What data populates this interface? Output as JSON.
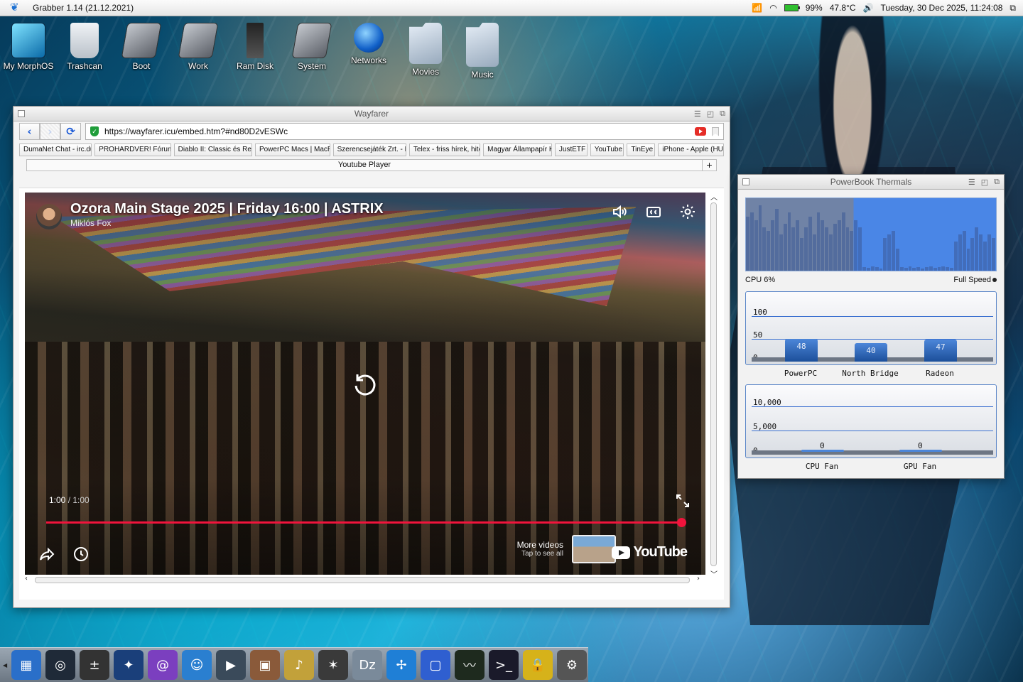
{
  "menubar": {
    "app_title": "Grabber 1.14 (21.12.2021)",
    "battery": "99%",
    "temperature": "47.8°C",
    "clock": "Tuesday, 30 Dec 2025, 11:24:08"
  },
  "desktop_icons": [
    {
      "label": "My MorphOS",
      "icon": "morphos-drive-icon"
    },
    {
      "label": "Trashcan",
      "icon": "trashcan-icon"
    },
    {
      "label": "Boot",
      "icon": "boot-drive-icon"
    },
    {
      "label": "Work",
      "icon": "work-drive-icon"
    },
    {
      "label": "Ram Disk",
      "icon": "ram-disk-icon"
    },
    {
      "label": "System",
      "icon": "system-drive-icon"
    },
    {
      "label": "Networks",
      "icon": "globe-icon"
    },
    {
      "label": "Movies",
      "icon": "folder-link-icon"
    },
    {
      "label": "Music",
      "icon": "folder-link-icon"
    }
  ],
  "wayfarer": {
    "title": "Wayfarer",
    "url": "https://wayfarer.icu/embed.htm?#nd80D2vESWc",
    "bookmarks": [
      "DumaNet Chat - irc.du",
      "PROHARDVER! Fórum",
      "Diablo II: Classic és Res",
      "PowerPC Macs | MacR",
      "Szerencsejáték Zrt. - L",
      "Telex - friss hírek, hite",
      "Magyar Állampapír K",
      "JustETF",
      "YouTube",
      "TinEye",
      "iPhone - Apple (HU)"
    ],
    "tab": "Youtube Player",
    "tab_add": "+",
    "video": {
      "title": "Ozora Main Stage 2025 | Friday 16:00 | ASTRIX",
      "channel": "Miklós Fox",
      "time_current": "1:00",
      "time_sep": " / ",
      "time_total": "1:00",
      "progress": 1.0,
      "more_videos": "More videos",
      "more_videos_sub": "Tap to see all",
      "logo_text": "YouTube"
    }
  },
  "thermals": {
    "title": "PowerBook Thermals",
    "cpu_label": "CPU 6%",
    "speed_label": "Full Speed",
    "cpu_history": [
      0.75,
      0.8,
      0.7,
      0.9,
      0.6,
      0.55,
      0.7,
      0.85,
      0.5,
      0.65,
      0.8,
      0.6,
      0.7,
      0.45,
      0.6,
      0.75,
      0.5,
      0.8,
      0.7,
      0.6,
      0.5,
      0.65,
      0.7,
      0.8,
      0.6,
      0.55,
      0.7,
      0.6,
      0.05,
      0.04,
      0.06,
      0.05,
      0.03,
      0.45,
      0.5,
      0.55,
      0.3,
      0.05,
      0.04,
      0.06,
      0.04,
      0.05,
      0.03,
      0.05,
      0.06,
      0.04,
      0.05,
      0.06,
      0.05,
      0.04,
      0.4,
      0.5,
      0.55,
      0.3,
      0.45,
      0.6,
      0.5,
      0.4,
      0.5,
      0.45
    ],
    "temp_chart": {
      "type": "bar",
      "categories": [
        "PowerPC",
        "North Bridge",
        "Radeon"
      ],
      "values": [
        48,
        40,
        47
      ],
      "ylim": [
        0,
        100
      ],
      "ticks": [
        "100",
        "50",
        "0"
      ]
    },
    "fan_chart": {
      "type": "bar",
      "categories": [
        "CPU Fan",
        "GPU Fan"
      ],
      "values": [
        0,
        0
      ],
      "ylim": [
        0,
        10000
      ],
      "ticks": [
        "10,000",
        "5,000",
        "0"
      ]
    }
  },
  "dock": [
    "finder-icon",
    "monitor-icon",
    "calculator-icon",
    "compass-icon",
    "mail-icon",
    "user-icon",
    "media-player-icon",
    "photos-icon",
    "flute-icon",
    "witch-icon",
    "dizzy-icon",
    "fan-icon",
    "screenshot-icon",
    "activity-icon",
    "terminal-icon",
    "lock-icon",
    "settings-icon"
  ]
}
